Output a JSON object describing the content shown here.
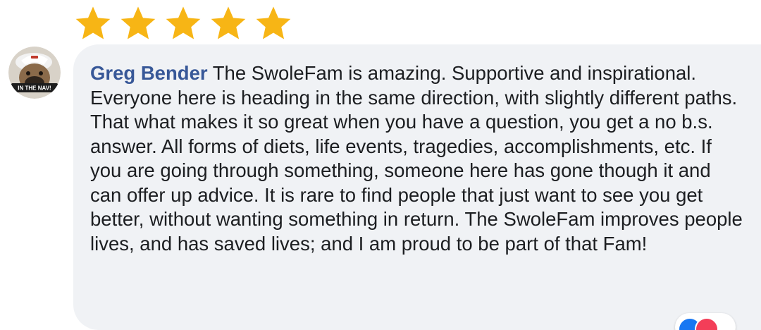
{
  "rating": {
    "stars": 5,
    "max": 5,
    "color": "#f7b515"
  },
  "comment": {
    "author": "Greg Bender",
    "body": "The SwoleFam is amazing. Supportive and inspirational. Everyone here is heading in the same direction, with slightly different paths. That what makes it so great when you have a question, you get a no b.s. answer. All forms of diets, life events, tragedies, accomplishments, etc. If you are going through something, someone here has gone though it and can offer up advice. It is rare to find people that just want to see you get better, without wanting something in return. The SwoleFam improves people lives, and has saved lives; and I am proud to be part of that Fam!",
    "avatar_caption": "IN THE NAV!",
    "author_color": "#385898",
    "bubble_color": "#f0f2f5"
  },
  "reactions": {
    "icons": [
      "like-icon",
      "love-icon"
    ],
    "like_color": "#1877f2",
    "love_color": "#f33e58"
  }
}
